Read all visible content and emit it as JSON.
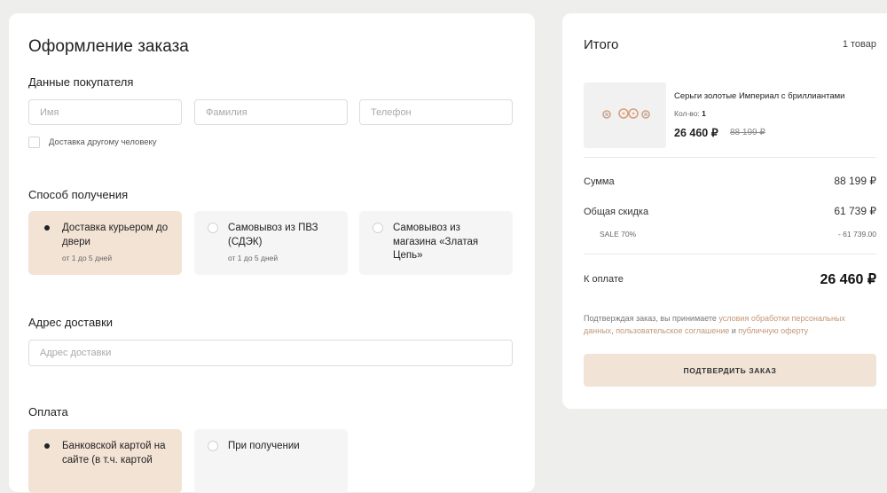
{
  "checkout": {
    "title": "Оформление заказа",
    "buyer": {
      "title": "Данные покупателя",
      "first_name_placeholder": "Имя",
      "last_name_placeholder": "Фамилия",
      "phone_placeholder": "Телефон",
      "other_person_label": "Доставка другому человеку"
    },
    "delivery": {
      "title": "Способ получения",
      "options": [
        {
          "label": "Доставка курьером до двери",
          "sub": "от 1 до 5 дней",
          "selected": true
        },
        {
          "label": "Самовывоз из ПВЗ (СДЭК)",
          "sub": "от 1 до 5 дней",
          "selected": false
        },
        {
          "label": "Самовывоз из магазина «Златая Цепь»",
          "sub": "",
          "selected": false
        }
      ]
    },
    "address": {
      "title": "Адрес доставки",
      "placeholder": "Адрес доставки"
    },
    "payment": {
      "title": "Оплата",
      "options": [
        {
          "label": "Банковской картой на сайте (в т.ч. картой",
          "selected": true
        },
        {
          "label": "При получении",
          "selected": false
        }
      ]
    }
  },
  "summary": {
    "title": "Итого",
    "count": "1 товар",
    "product": {
      "name": "Серьги золотые Империал с бриллиантами",
      "qty_label": "Кол-во:",
      "qty": "1",
      "price": "26 460 ₽",
      "old_price": "88 199 ₽",
      "image_icon": "earrings-image"
    },
    "sum_label": "Сумма",
    "sum_value": "88 199 ₽",
    "discount_label": "Общая скидка",
    "discount_value": "61 739 ₽",
    "sale_label": "SALE 70%",
    "sale_value": "- 61 739.00",
    "total_label": "К оплате",
    "total_value": "26 460 ₽",
    "legal": {
      "prefix": "Подтверждая заказ, вы принимаете ",
      "link1": "условия обработки персональных данных",
      "sep1": ", ",
      "link2": "пользовательское соглашение",
      "sep2": " и ",
      "link3": "публичную оферту"
    },
    "confirm_label": "ПОДТВЕРДИТЬ ЗАКАЗ"
  },
  "colors": {
    "accent_bg": "#f3e3d5",
    "link": "#c39777",
    "page_bg": "#eeeeec"
  }
}
